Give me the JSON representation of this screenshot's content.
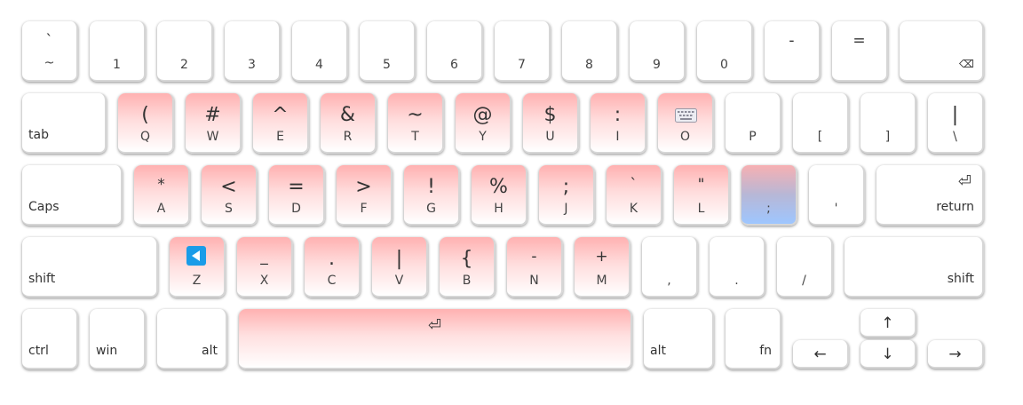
{
  "keyboard": {
    "row1": [
      {
        "id": "backtick",
        "top": "`",
        "bottom": "~"
      },
      {
        "id": "1",
        "bottom": "1"
      },
      {
        "id": "2",
        "bottom": "2"
      },
      {
        "id": "3",
        "bottom": "3"
      },
      {
        "id": "4",
        "bottom": "4"
      },
      {
        "id": "5",
        "bottom": "5"
      },
      {
        "id": "6",
        "bottom": "6"
      },
      {
        "id": "7",
        "bottom": "7"
      },
      {
        "id": "8",
        "bottom": "8"
      },
      {
        "id": "9",
        "bottom": "9"
      },
      {
        "id": "0",
        "bottom": "0"
      },
      {
        "id": "minus",
        "top": "-"
      },
      {
        "id": "equals",
        "top": "="
      },
      {
        "id": "backspace",
        "icon": "backspace-icon",
        "glyph": "⌫"
      }
    ],
    "row2": [
      {
        "id": "tab",
        "label": "tab"
      },
      {
        "id": "q",
        "top": "(",
        "bottom": "Q"
      },
      {
        "id": "w",
        "top": "#",
        "bottom": "W"
      },
      {
        "id": "e",
        "top": "^",
        "bottom": "E"
      },
      {
        "id": "r",
        "top": "&",
        "bottom": "R"
      },
      {
        "id": "t",
        "top": "~",
        "bottom": "T"
      },
      {
        "id": "y",
        "top": "@",
        "bottom": "Y"
      },
      {
        "id": "u",
        "top": "$",
        "bottom": "U"
      },
      {
        "id": "i",
        "top": ":",
        "bottom": "I"
      },
      {
        "id": "o",
        "icon": "keyboard-icon",
        "bottom": "O"
      },
      {
        "id": "p",
        "bottom": "P"
      },
      {
        "id": "lbracket",
        "bottom": "["
      },
      {
        "id": "rbracket",
        "bottom": "]"
      },
      {
        "id": "backslash",
        "top": "|",
        "bottom": "\\"
      }
    ],
    "row3": [
      {
        "id": "caps",
        "label": "Caps"
      },
      {
        "id": "a",
        "top": "*",
        "bottom": "A"
      },
      {
        "id": "s",
        "top": "<",
        "bottom": "S"
      },
      {
        "id": "d",
        "top": "=",
        "bottom": "D"
      },
      {
        "id": "f",
        "top": ">",
        "bottom": "F"
      },
      {
        "id": "g",
        "top": "!",
        "bottom": "G"
      },
      {
        "id": "h",
        "top": "%",
        "bottom": "H"
      },
      {
        "id": "j",
        "top": ";",
        "bottom": "J"
      },
      {
        "id": "k",
        "top": "`",
        "bottom": "K"
      },
      {
        "id": "l",
        "top": "\"",
        "bottom": "L"
      },
      {
        "id": "semicolon",
        "bottom": ";"
      },
      {
        "id": "quote",
        "bottom": "'"
      },
      {
        "id": "return",
        "icon": "return-icon",
        "glyph": "⏎",
        "label": "return"
      }
    ],
    "row4": [
      {
        "id": "lshift",
        "label": "shift"
      },
      {
        "id": "z",
        "icon": "play-back-icon",
        "bottom": "Z"
      },
      {
        "id": "x",
        "top": "_",
        "bottom": "X"
      },
      {
        "id": "c",
        "top": ".",
        "bottom": "C"
      },
      {
        "id": "v",
        "top": "|",
        "bottom": "V"
      },
      {
        "id": "b",
        "top": "{",
        "bottom": "B"
      },
      {
        "id": "n",
        "top": "-",
        "bottom": "N"
      },
      {
        "id": "m",
        "top": "+",
        "bottom": "M"
      },
      {
        "id": "comma",
        "bottom": ","
      },
      {
        "id": "period",
        "bottom": "."
      },
      {
        "id": "slash",
        "bottom": "/"
      },
      {
        "id": "rshift",
        "label": "shift"
      }
    ],
    "row5": [
      {
        "id": "ctrl",
        "label": "ctrl"
      },
      {
        "id": "win",
        "label": "win"
      },
      {
        "id": "lalt",
        "label": "alt"
      },
      {
        "id": "space",
        "icon": "enter-icon",
        "glyph": "⏎"
      },
      {
        "id": "ralt",
        "label": "alt"
      },
      {
        "id": "fn",
        "label": "fn"
      },
      {
        "id": "left",
        "icon": "arrow-left-icon",
        "glyph": "←"
      },
      {
        "id": "up",
        "icon": "arrow-up-icon",
        "glyph": "↑"
      },
      {
        "id": "down",
        "icon": "arrow-down-icon",
        "glyph": "↓"
      },
      {
        "id": "right",
        "icon": "arrow-right-icon",
        "glyph": "→"
      }
    ],
    "colors": {
      "highlight_pink": "#ffb1b1",
      "highlight_blue": "#9ec6ff",
      "icon_blue": "#1a9ce8"
    }
  }
}
